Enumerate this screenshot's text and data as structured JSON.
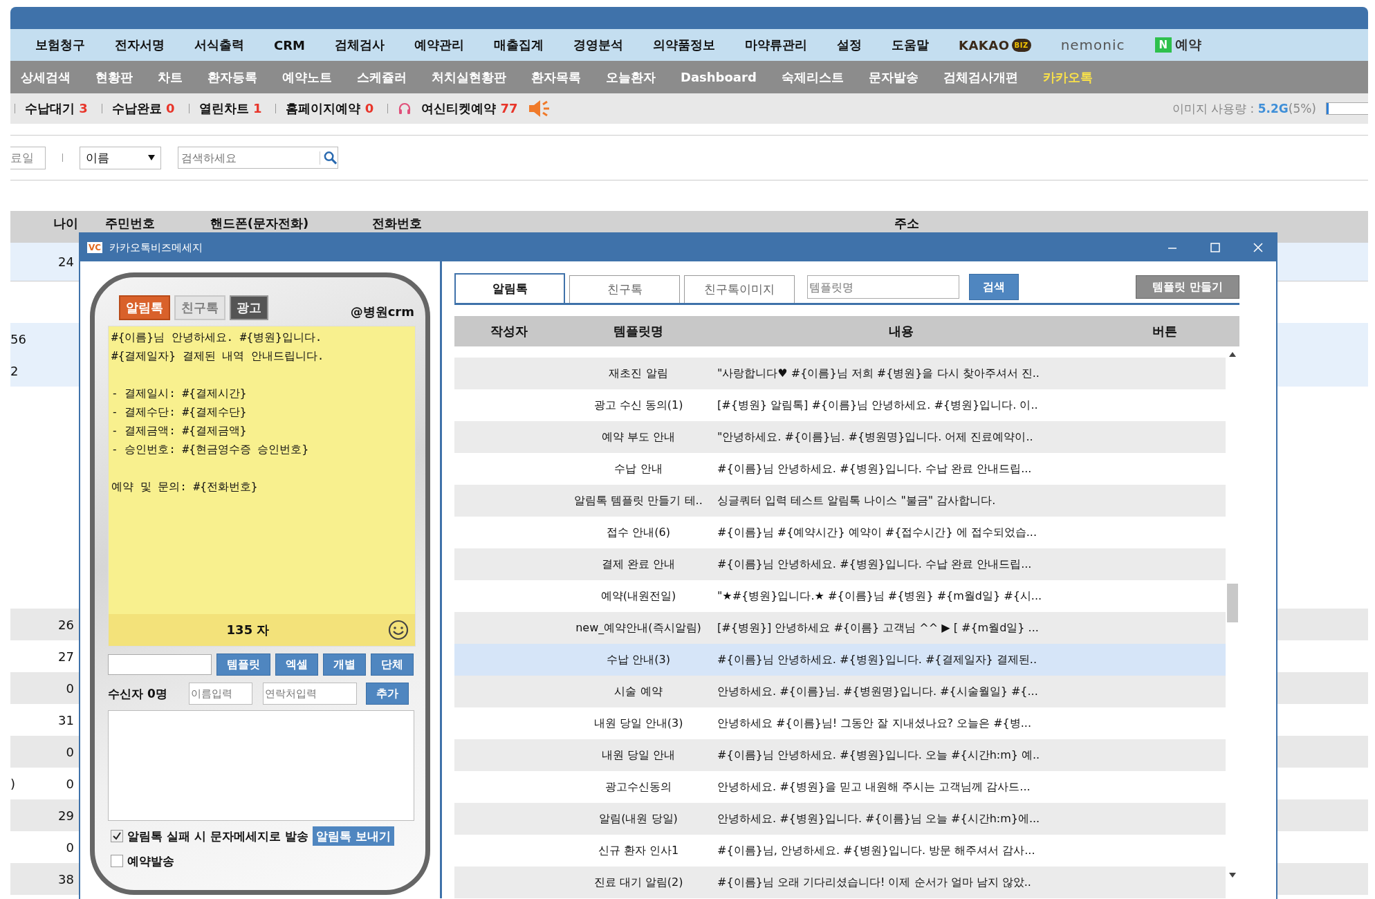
{
  "main_menu": [
    "보험청구",
    "전자서명",
    "서식출력",
    "CRM",
    "검체검사",
    "예약관리",
    "매출집계",
    "경영분석",
    "의약품정보",
    "마약류관리",
    "설정",
    "도움말"
  ],
  "brand_links": [
    {
      "kind": "kakao",
      "label": "KAKAO",
      "badge": "BIZ"
    },
    {
      "kind": "nemonic",
      "label": "nemonic"
    },
    {
      "kind": "naver",
      "badge": "N",
      "label": "예약"
    }
  ],
  "sub_menu": [
    {
      "label": "상세검색",
      "selected": false
    },
    {
      "label": "현황판",
      "selected": false
    },
    {
      "label": "차트",
      "selected": false
    },
    {
      "label": "환자등록",
      "selected": false
    },
    {
      "label": "예약노트",
      "selected": false
    },
    {
      "label": "스케쥴러",
      "selected": false
    },
    {
      "label": "처치실현황판",
      "selected": false
    },
    {
      "label": "환자목록",
      "selected": false
    },
    {
      "label": "오늘환자",
      "selected": false
    },
    {
      "label": "Dashboard",
      "selected": false
    },
    {
      "label": "숙제리스트",
      "selected": false
    },
    {
      "label": "문자발송",
      "selected": false
    },
    {
      "label": "검체검사개편",
      "selected": false
    },
    {
      "label": "카카오톡",
      "selected": true
    }
  ],
  "status_bar": {
    "items": [
      {
        "label": "수납대기",
        "count": "3"
      },
      {
        "label": "수납완료",
        "count": "0"
      },
      {
        "label": "열린차트",
        "count": "1"
      },
      {
        "label": "홈페이지예약",
        "count": "0"
      },
      {
        "label": "여신티켓예약",
        "count": "77",
        "kind": "headset"
      }
    ],
    "usage": {
      "label": "이미지 사용량 : ",
      "value": "5.2G",
      "percent": "(5%)",
      "level": 0.05
    }
  },
  "filter": {
    "date_value": "료일",
    "select_value": "이름",
    "search_placeholder": "검색하세요"
  },
  "bg_table": {
    "columns": [
      "나이",
      "주민번호",
      "핸드폰(문자전화)",
      "전화번호",
      "주소"
    ],
    "rows": [
      {
        "column_1": "",
        "age": "24",
        "selected": true
      },
      {
        "column_1": "56",
        "age": "",
        "selected": true
      },
      {
        "column_1": "2",
        "age": "",
        "selected": true
      },
      {
        "column_1": "",
        "age": "26",
        "selected": false
      },
      {
        "column_1": "",
        "age": "27",
        "selected": false
      },
      {
        "column_1": "",
        "age": "0",
        "selected": false
      },
      {
        "column_1": "",
        "age": "31",
        "selected": false
      },
      {
        "column_1": "",
        "age": "0",
        "selected": false
      },
      {
        "column_1": ")",
        "age": "0",
        "selected": false
      },
      {
        "column_1": "",
        "age": "29",
        "selected": false
      },
      {
        "column_1": "",
        "age": "0",
        "selected": false
      },
      {
        "column_1": "",
        "age": "38",
        "selected": false
      }
    ]
  },
  "dialog": {
    "title": "카카오톡비즈메세지",
    "logo": "VC",
    "phone": {
      "tabs": [
        {
          "label": "알림톡",
          "selected": true,
          "disabled": false
        },
        {
          "label": "친구톡",
          "selected": false,
          "disabled": true
        },
        {
          "label": "광고",
          "selected": false,
          "disabled": false
        }
      ],
      "sender": "@병원crm",
      "message": "#{이름}님 안녕하세요. #{병원}입니다.\n#{결제일자} 결제된 내역 안내드립니다.\n\n- 결제일시: #{결제시간}\n- 결제수단: #{결제수단}\n- 결제금액: #{결제금액}\n- 승인번호: #{현금영수증 승인번호}\n\n예약 및 문의: #{전화번호}",
      "char_count": "135 자",
      "tool_buttons": [
        "템플릿",
        "엑셀",
        "개별",
        "단체"
      ],
      "recipients_label": "수신자 0명",
      "name_placeholder": "이름입력",
      "phone_placeholder": "연락처입력",
      "add_button": "추가",
      "fallback": {
        "label": "알림톡 실패 시 문자메세지로 발송",
        "checked": true
      },
      "send_button": "알림톡 보내기",
      "reserve": {
        "label": "예약발송",
        "checked": false
      }
    },
    "templates": {
      "tabs": [
        {
          "label": "알림톡",
          "selected": true
        },
        {
          "label": "친구톡",
          "selected": false
        },
        {
          "label": "친구톡이미지",
          "selected": false
        }
      ],
      "search_placeholder": "템플릿명",
      "search_button": "검색",
      "create_button": "템플릿 만들기",
      "columns": [
        "작성자",
        "템플릿명",
        "내용",
        "버튼"
      ],
      "rows": [
        {
          "name": "재초진 알림",
          "content": "\"사랑합니다♥ #{이름}님 저희 #{병원}을 다시 찾아주셔서 진..",
          "selected": false
        },
        {
          "name": "광고 수신 동의(1)",
          "content": "[#{병원} 알림톡] #{이름}님 안녕하세요. #{병원}입니다. 이..",
          "selected": false
        },
        {
          "name": "예약 부도 안내",
          "content": "\"안녕하세요. #{이름}님. #{병원명}입니다. 어제 진료예약이..",
          "selected": false
        },
        {
          "name": "수납 안내",
          "content": "#{이름}님 안녕하세요. #{병원}입니다. 수납 완료 안내드립...",
          "selected": false
        },
        {
          "name": "알림톡 템플릿 만들기 테..",
          "content": "싱글쿼터 입력 테스트 알림톡 나이스 \"불금\" 감사합니다.",
          "selected": false
        },
        {
          "name": "접수 안내(6)",
          "content": "#{이름}님 #{예약시간} 예약이 #{접수시간} 에 접수되었습...",
          "selected": false
        },
        {
          "name": "결제 완료 안내",
          "content": "#{이름}님 안녕하세요. #{병원}입니다. 수납 완료 안내드립...",
          "selected": false
        },
        {
          "name": "예약(내원전일)",
          "content": "\"★#{병원}입니다.★ #{이름}님 #{병원} #{m월d일} #{시...",
          "selected": false
        },
        {
          "name": "new_예약안내(즉시알림)",
          "content": "[#{병원}] 안녕하세요 #{이름} 고객님 ^^ ▶ [ #{m월d일} ...",
          "selected": false
        },
        {
          "name": "수납 안내(3)",
          "content": "#{이름}님 안녕하세요. #{병원}입니다. #{결제일자} 결제된..",
          "selected": true
        },
        {
          "name": "시술 예약",
          "content": "안녕하세요. #{이름}님. #{병원명}입니다. #{시술월일} #{...",
          "selected": false
        },
        {
          "name": "내원 당일 안내(3)",
          "content": "안녕하세요 #{이름}님! 그동안 잘 지내셨나요? 오늘은 #{병...",
          "selected": false
        },
        {
          "name": "내원 당일 안내",
          "content": "#{이름}님 안녕하세요. #{병원}입니다. 오늘 #{시간h:m} 예..",
          "selected": false
        },
        {
          "name": "광고수신동의",
          "content": "안녕하세요. #{병원}을 믿고 내원해 주시는 고객님께 감사드...",
          "selected": false
        },
        {
          "name": "알림(내원 당일)",
          "content": "안녕하세요. #{병원}입니다. #{이름}님 오늘 #{시간h:m}에...",
          "selected": false
        },
        {
          "name": "신규 환자 인사1",
          "content": "#{이름}님, 안녕하세요. #{병원}입니다. 방문 해주셔서 감사...",
          "selected": false
        },
        {
          "name": "진료 대기 알림(2)",
          "content": "#{이름}님 오래 기다리셨습니다! 이제 순서가 얼마 남지 않았..",
          "selected": false
        }
      ]
    }
  }
}
